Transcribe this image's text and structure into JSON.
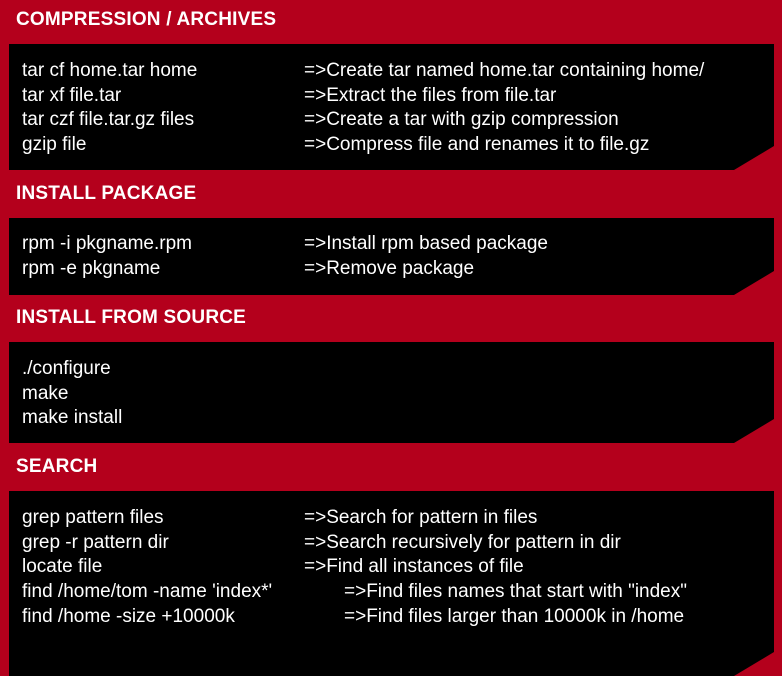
{
  "sections": [
    {
      "title": "COMPRESSION / ARCHIVES",
      "rows": [
        {
          "cmd": "tar cf home.tar home",
          "desc": "=>Create tar named home.tar containing home/"
        },
        {
          "cmd": "tar xf file.tar",
          "desc": "=>Extract the files from file.tar"
        },
        {
          "cmd": "tar czf file.tar.gz files",
          "desc": "=>Create a tar with gzip compression"
        },
        {
          "cmd": "gzip file",
          "desc": "=>Compress file and renames it to file.gz"
        }
      ]
    },
    {
      "title": "INSTALL PACKAGE",
      "rows": [
        {
          "cmd": "rpm -i pkgname.rpm",
          "desc": "=>Install rpm based package"
        },
        {
          "cmd": "rpm -e pkgname",
          "desc": "=>Remove package"
        }
      ]
    },
    {
      "title": "INSTALL FROM SOURCE",
      "rows": [
        {
          "cmd": "./configure",
          "desc": ""
        },
        {
          "cmd": "make",
          "desc": ""
        },
        {
          "cmd": "make install",
          "desc": ""
        }
      ]
    },
    {
      "title": "SEARCH",
      "rows": [
        {
          "cmd": "grep pattern files",
          "desc": "=>Search for pattern in files"
        },
        {
          "cmd": "grep -r pattern dir",
          "desc": "=>Search recursively for pattern in dir"
        },
        {
          "cmd": "locate file",
          "desc": "=>Find all instances of file"
        },
        {
          "cmd": "find /home/tom -name 'index*'",
          "desc": "=>Find files names that start with \"index\""
        },
        {
          "cmd": "find /home -size +10000k",
          "desc": "=>Find files larger than 10000k in /home"
        }
      ]
    }
  ],
  "colors": {
    "background": "#b4001c",
    "box": "#000000",
    "text": "#ffffff"
  }
}
